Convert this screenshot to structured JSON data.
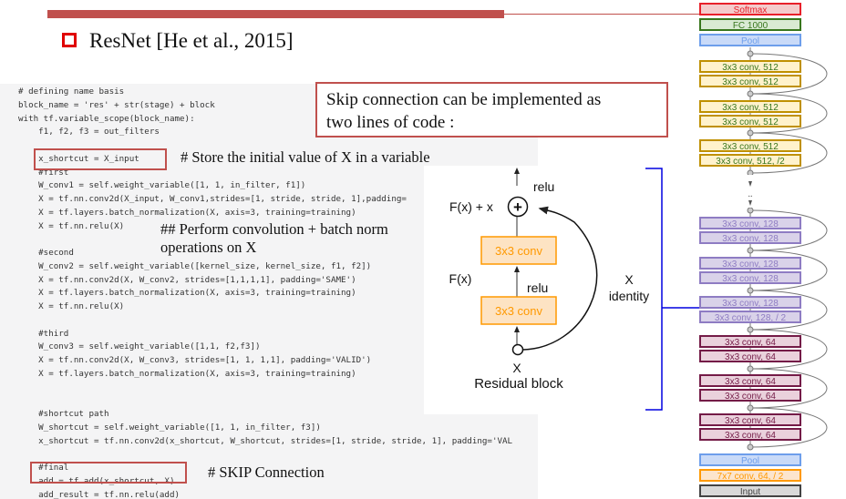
{
  "title": "ResNet [He et al., 2015]",
  "skip_note": {
    "line1": "Skip connection can be implemented as",
    "line2": "two lines of code :"
  },
  "comments": {
    "store": "# Store the initial value of X in a variable",
    "perform1": "## Perform convolution + batch norm",
    "perform2": "operations on X",
    "skip": "# SKIP Connection"
  },
  "code_lines": [
    "# defining name basis",
    "block_name = 'res' + str(stage) + block",
    "with tf.variable_scope(block_name):",
    "    f1, f2, f3 = out_filters",
    "",
    "    x_shortcut = X_input",
    "    #first",
    "    W_conv1 = self.weight_variable([1, 1, in_filter, f1])",
    "    X = tf.nn.conv2d(X_input, W_conv1,strides=[1, stride, stride, 1],padding=",
    "    X = tf.layers.batch_normalization(X, axis=3, training=training)",
    "    X = tf.nn.relu(X)",
    "",
    "    #second",
    "    W_conv2 = self.weight_variable([kernel_size, kernel_size, f1, f2])",
    "    X = tf.nn.conv2d(X, W_conv2, strides=[1,1,1,1], padding='SAME')",
    "    X = tf.layers.batch_normalization(X, axis=3, training=training)",
    "    X = tf.nn.relu(X)",
    "",
    "    #third",
    "    W_conv3 = self.weight_variable([1,1, f2,f3])",
    "    X = tf.nn.conv2d(X, W_conv3, strides=[1, 1, 1,1], padding='VALID')",
    "    X = tf.layers.batch_normalization(X, axis=3, training=training)",
    "",
    "",
    "    #shortcut path",
    "    W_shortcut = self.weight_variable([1, 1, in_filter, f3])",
    "    x_shortcut = tf.nn.conv2d(x_shortcut, W_shortcut, strides=[1, stride, stride, 1], padding='VAL",
    "",
    "    #final",
    "    add = tf.add(x_shortcut, X)",
    "    add_result = tf.nn.relu(add)"
  ],
  "residual_block": {
    "relu_top": "relu",
    "sum_label": "F(x) + x",
    "plus": "+",
    "conv_top": "3x3 conv",
    "relu_mid": "relu",
    "conv_bottom": "3x3 conv",
    "fx": "F(x)",
    "x_identity_1": "X",
    "x_identity_2": "identity",
    "x_input": "X",
    "caption": "Residual block",
    "conv_color": "#ff9900"
  },
  "network": [
    {
      "label": "Softmax",
      "kind": "softmax"
    },
    {
      "label": "FC 1000",
      "kind": "fc"
    },
    {
      "label": "Pool",
      "kind": "pool"
    },
    {
      "label": "3x3 conv, 512",
      "kind": "c512"
    },
    {
      "label": "3x3 conv, 512",
      "kind": "c512"
    },
    {
      "label": "3x3 conv, 512",
      "kind": "c512"
    },
    {
      "label": "3x3 conv, 512",
      "kind": "c512"
    },
    {
      "label": "3x3 conv, 512",
      "kind": "c512"
    },
    {
      "label": "3x3 conv, 512, /2",
      "kind": "c512"
    },
    {
      "label": "3x3 conv, 128",
      "kind": "c128"
    },
    {
      "label": "3x3 conv, 128",
      "kind": "c128"
    },
    {
      "label": "3x3 conv, 128",
      "kind": "c128"
    },
    {
      "label": "3x3 conv, 128",
      "kind": "c128"
    },
    {
      "label": "3x3 conv, 128",
      "kind": "c128"
    },
    {
      "label": "3x3 conv, 128, / 2",
      "kind": "c128"
    },
    {
      "label": "3x3 conv, 64",
      "kind": "c64"
    },
    {
      "label": "3x3 conv, 64",
      "kind": "c64"
    },
    {
      "label": "3x3 conv, 64",
      "kind": "c64"
    },
    {
      "label": "3x3 conv, 64",
      "kind": "c64"
    },
    {
      "label": "3x3 conv, 64",
      "kind": "c64"
    },
    {
      "label": "3x3 conv, 64",
      "kind": "c64"
    },
    {
      "label": "Pool",
      "kind": "pool"
    },
    {
      "label": "7x7 conv, 64, / 2",
      "kind": "c7"
    },
    {
      "label": "Input",
      "kind": "input"
    }
  ],
  "colors": {
    "accent_red": "#c0504d",
    "bracket_blue": "#0000e0",
    "softmax": [
      "#f4cccc",
      "#e8202a",
      "#e8202a"
    ],
    "fc": [
      "#d9ead3",
      "#38761d",
      "#38761d"
    ],
    "pool": [
      "#c9daf8",
      "#6d9eeb",
      "#6d9eeb"
    ],
    "c512": [
      "#fff2cc",
      "#bf9000",
      "#38761d"
    ],
    "c128": [
      "#d9d2e9",
      "#8e7cc3",
      "#8e7cc3"
    ],
    "c64": [
      "#ead1dc",
      "#741b47",
      "#741b47"
    ],
    "c7": [
      "#fce5cd",
      "#ff9900",
      "#ff9900"
    ],
    "input": [
      "#d9d9d9",
      "#434343",
      "#434343"
    ]
  }
}
